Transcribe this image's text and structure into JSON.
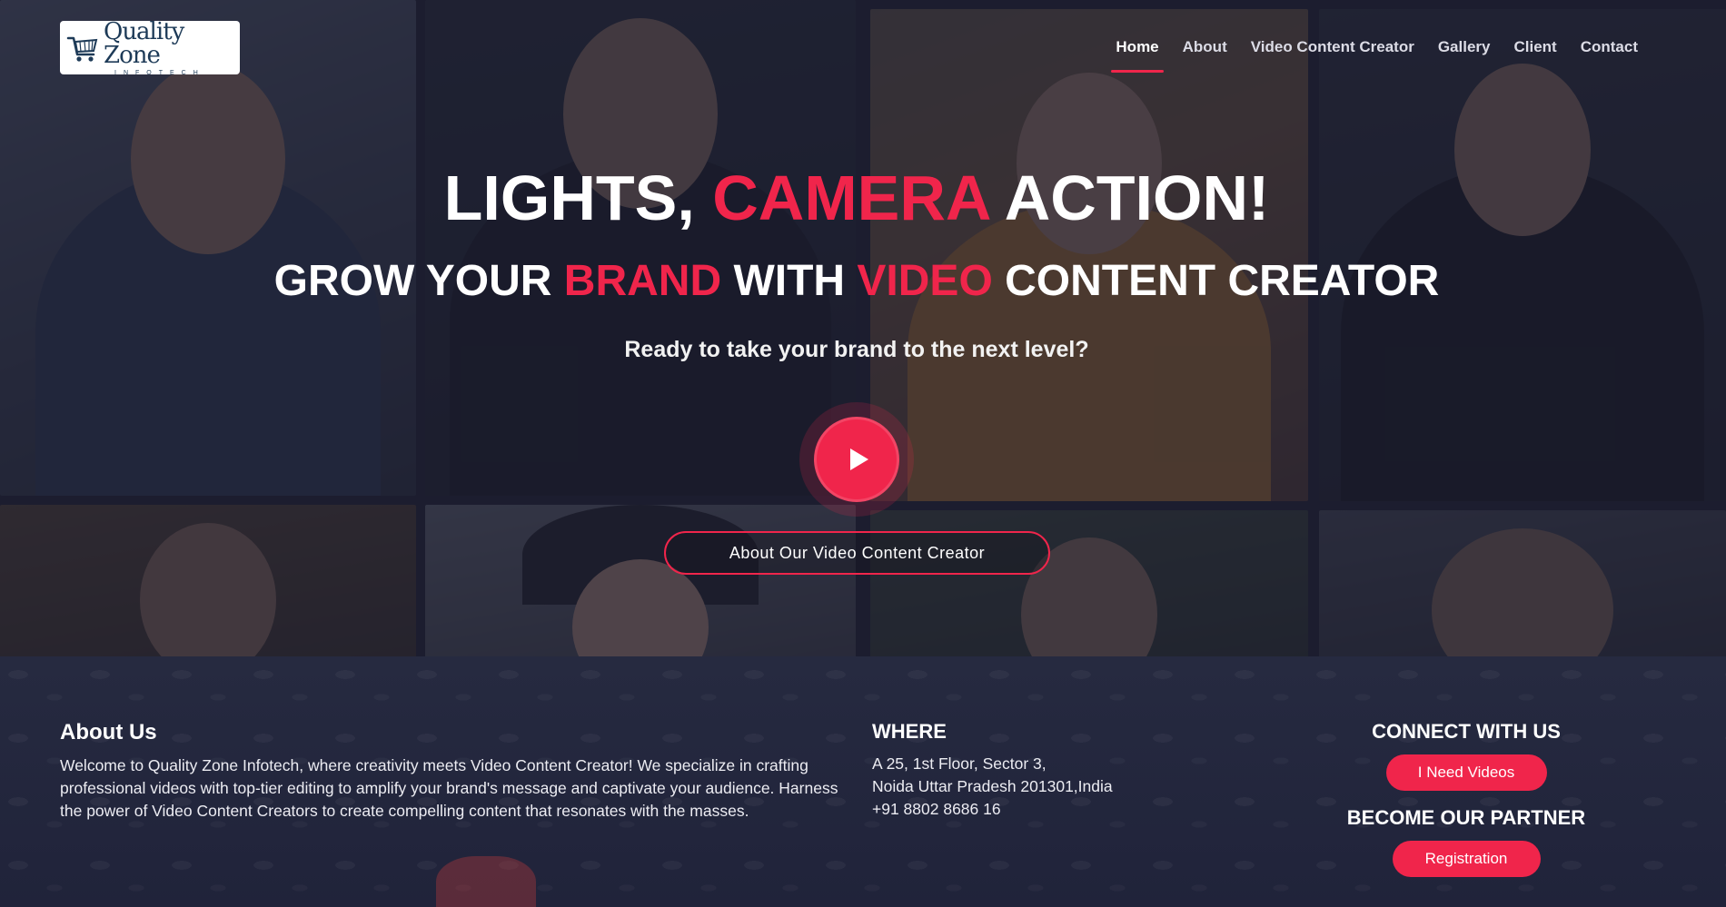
{
  "brand": {
    "logo_name": "Quality Zone",
    "logo_sub": "INFOTECH",
    "accent_color": "#f0254b"
  },
  "nav": {
    "items": [
      {
        "label": "Home",
        "active": true
      },
      {
        "label": "About"
      },
      {
        "label": "Video Content Creator"
      },
      {
        "label": "Gallery"
      },
      {
        "label": "Client"
      },
      {
        "label": "Contact"
      }
    ]
  },
  "hero": {
    "headline": {
      "part1": "LIGHTS, ",
      "accent": "CAMERA",
      "part2": " ACTION!"
    },
    "subheadline": {
      "p1": "GROW YOUR ",
      "a1": "BRAND",
      "p2": " WITH ",
      "a2": "VIDEO",
      "p3": " CONTENT CREATOR"
    },
    "tagline": "Ready to take your brand to the next level?",
    "play_icon": "play-icon",
    "about_button": "About Our Video Content Creator"
  },
  "footer": {
    "about": {
      "heading": "About Us",
      "text": "Welcome to Quality Zone Infotech, where creativity meets Video Content Creator! We specialize in crafting professional videos with top-tier editing to amplify your brand's message and captivate your audience. Harness the power of Video Content Creators to create compelling content that resonates with the masses."
    },
    "where": {
      "heading": "WHERE",
      "line1": "A 25, 1st Floor, Sector 3,",
      "line2": "Noida Uttar Pradesh 201301,India",
      "phone": "+91 8802 8686 16"
    },
    "connect": {
      "heading": "CONNECT WITH US",
      "button": "I Need Videos",
      "partner_heading": "BECOME OUR PARTNER",
      "partner_button": "Registration"
    }
  }
}
